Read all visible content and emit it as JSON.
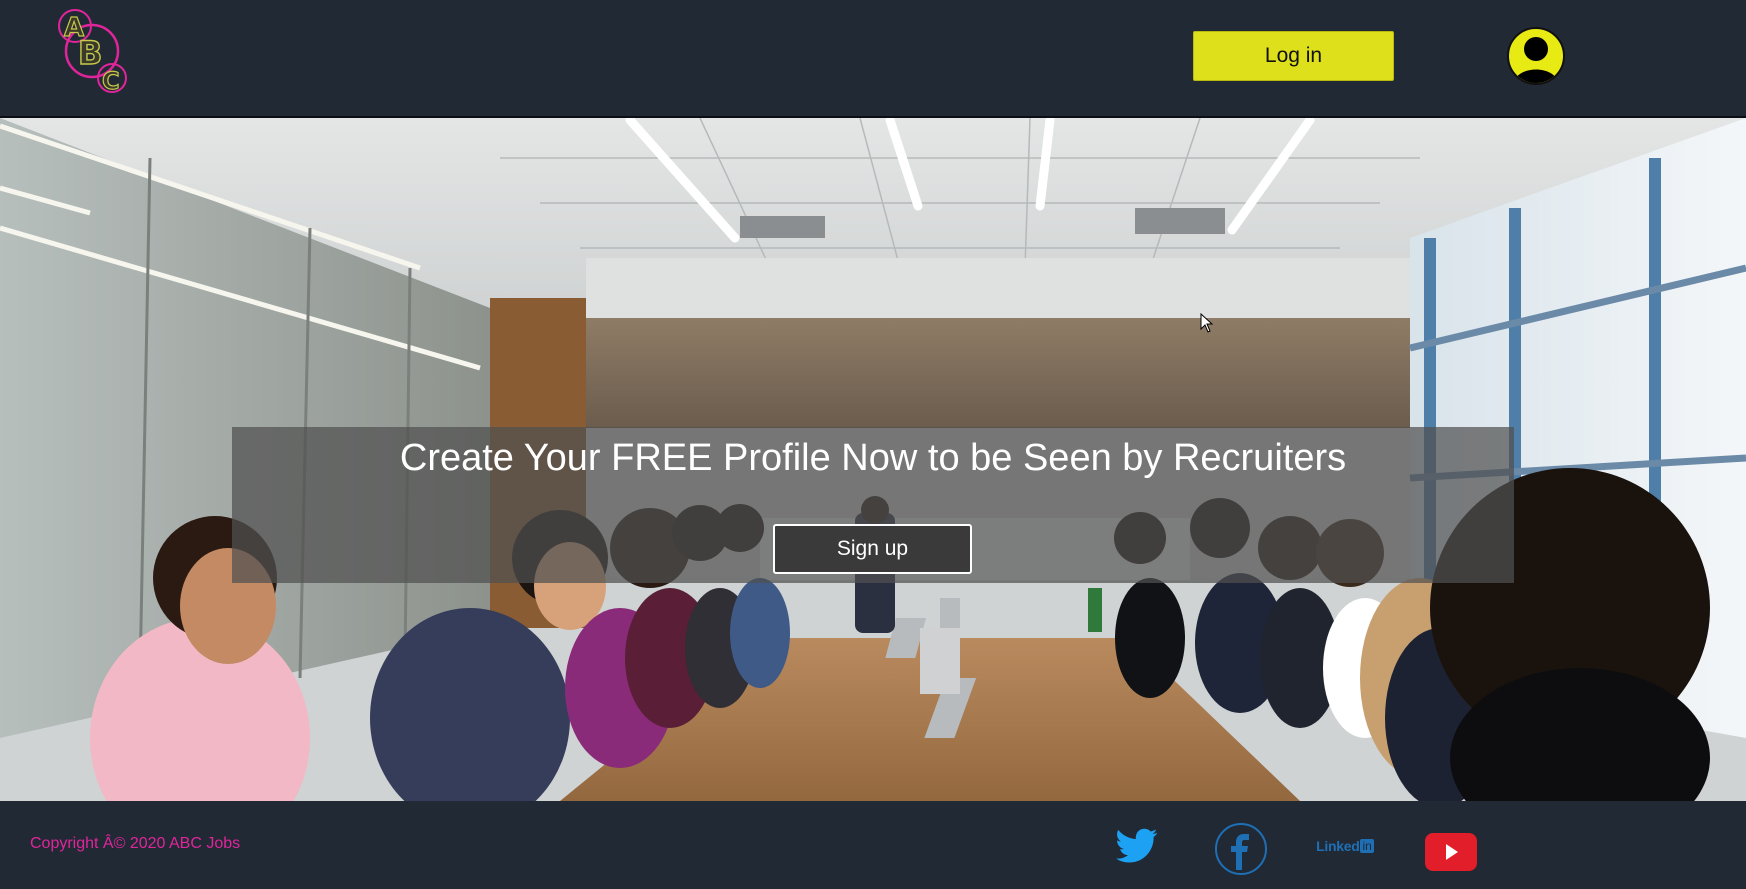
{
  "header": {
    "logo_letters": [
      "A",
      "B",
      "C"
    ],
    "login_label": "Log in"
  },
  "hero": {
    "title": "Create Your FREE Profile Now to be Seen by Recruiters",
    "signup_label": "Sign up",
    "background": "conference-room-meeting-photo"
  },
  "footer": {
    "copyright": "Copyright Â© 2020 ABC Jobs",
    "social": [
      {
        "name": "twitter-icon",
        "label": ""
      },
      {
        "name": "facebook-icon",
        "label": ""
      },
      {
        "name": "linkedin-icon",
        "label": "Linked",
        "label_suffix": "in"
      },
      {
        "name": "youtube-icon",
        "label": ""
      }
    ]
  },
  "colors": {
    "header_bg": "#212935",
    "login_bg": "#dde01a",
    "avatar_bg": "#e8ea14",
    "copyright": "#e0259a",
    "twitter": "#1da1f2",
    "facebook": "#1f6fb5",
    "youtube": "#e21e2a"
  }
}
